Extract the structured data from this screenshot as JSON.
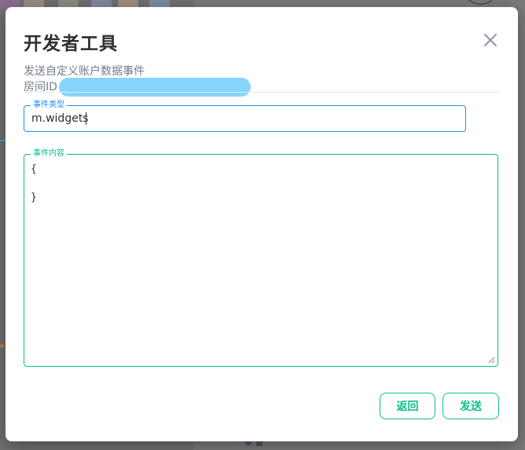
{
  "dialog": {
    "title": "开发者工具",
    "subtitle": "发送自定义账户数据事件",
    "room_id_label": "房间ID"
  },
  "event_type": {
    "label": "事件类型",
    "value": "m.widgets"
  },
  "event_content": {
    "label": "事件内容",
    "value": "{\n\n}"
  },
  "buttons": {
    "back_label": "返回",
    "send_label": "发送"
  },
  "colors": {
    "accent_green": "#0dbd8b",
    "focus_blue": "#238cf5",
    "title_text": "#2e2f32",
    "secondary_text": "#737d8c",
    "redaction": "#87d4ff"
  },
  "icons": {
    "close": "close-icon",
    "resize": "resize-grip-icon"
  }
}
